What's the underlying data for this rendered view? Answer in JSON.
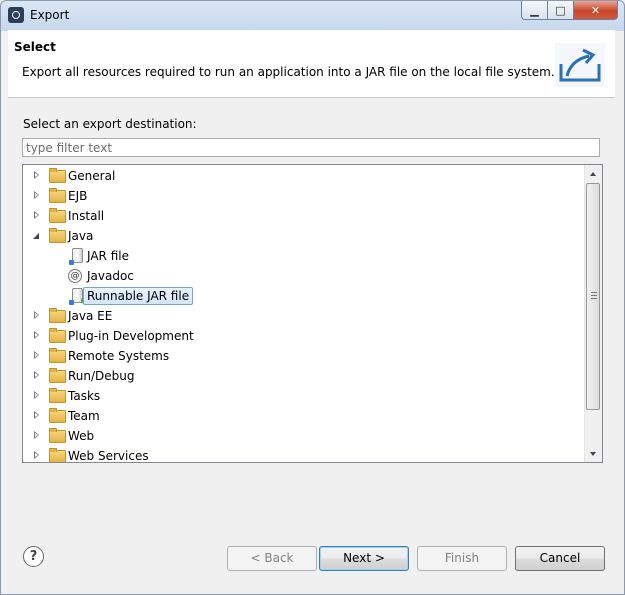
{
  "window": {
    "title": "Export",
    "min_glyph": "▁",
    "max_glyph": "□",
    "close_glyph": "✕"
  },
  "banner": {
    "title": "Select",
    "description": "Export all resources required to run an application into a JAR file on the local file system."
  },
  "destination": {
    "label": "Select an export destination:",
    "filter_placeholder": "type filter text"
  },
  "tree": [
    {
      "label": "General",
      "icon": "folder-icon",
      "expanded": false
    },
    {
      "label": "EJB",
      "icon": "folder-icon",
      "expanded": false
    },
    {
      "label": "Install",
      "icon": "folder-icon",
      "expanded": false
    },
    {
      "label": "Java",
      "icon": "folder-icon",
      "expanded": true
    },
    {
      "label": "JAR file",
      "icon": "jar-file-icon",
      "child": true
    },
    {
      "label": "Javadoc",
      "icon": "javadoc-icon",
      "child": true
    },
    {
      "label": "Runnable JAR file",
      "icon": "runnable-jar-icon",
      "child": true,
      "selected": true
    },
    {
      "label": "Java EE",
      "icon": "folder-icon",
      "expanded": false
    },
    {
      "label": "Plug-in Development",
      "icon": "folder-icon",
      "expanded": false
    },
    {
      "label": "Remote Systems",
      "icon": "folder-icon",
      "expanded": false
    },
    {
      "label": "Run/Debug",
      "icon": "folder-icon",
      "expanded": false
    },
    {
      "label": "Tasks",
      "icon": "folder-icon",
      "expanded": false
    },
    {
      "label": "Team",
      "icon": "folder-icon",
      "expanded": false
    },
    {
      "label": "Web",
      "icon": "folder-icon",
      "expanded": false
    },
    {
      "label": "Web Services",
      "icon": "folder-icon",
      "expanded": false
    }
  ],
  "buttons": {
    "help_glyph": "?",
    "back": "< Back",
    "next": "Next >",
    "finish": "Finish",
    "cancel": "Cancel"
  },
  "colors": {
    "selection_fill": "#d3e6fb",
    "selection_border": "#7da2ce",
    "close_button": "#c9462c"
  }
}
